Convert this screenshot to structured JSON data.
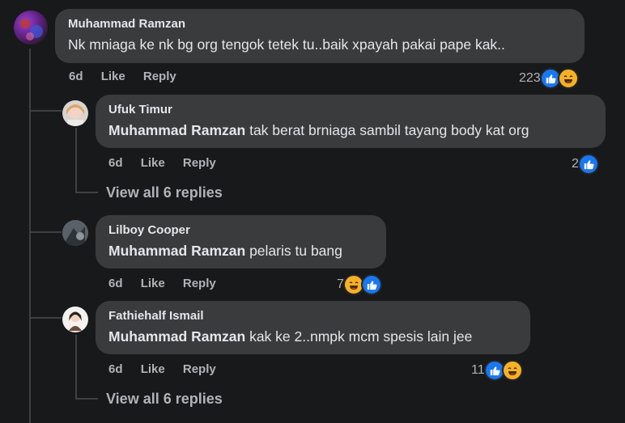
{
  "comments": [
    {
      "author": "Muhammad Ramzan",
      "mention": "",
      "text": "Nk mniaga ke nk bg org tengok tetek tu..baik xpayah pakai pape kak..",
      "time": "6d",
      "like": "Like",
      "reply": "Reply",
      "reaction_count": "223",
      "reactions": [
        "like-icon",
        "haha-icon"
      ]
    },
    {
      "author": "Ufuk Timur",
      "mention": "Muhammad Ramzan",
      "text": "tak berat brniaga sambil tayang body kat org",
      "time": "6d",
      "like": "Like",
      "reply": "Reply",
      "reaction_count": "2",
      "reactions": [
        "like-icon"
      ]
    },
    {
      "author": "Lilboy Cooper",
      "mention": "Muhammad Ramzan",
      "text": "pelaris tu bang",
      "time": "6d",
      "like": "Like",
      "reply": "Reply",
      "reaction_count": "7",
      "reactions": [
        "haha-icon",
        "like-icon"
      ]
    },
    {
      "author": "Fathiehalf Ismail",
      "mention": "Muhammad Ramzan",
      "text": "kak ke 2..nmpk mcm spesis lain jee",
      "time": "6d",
      "like": "Like",
      "reply": "Reply",
      "reaction_count": "11",
      "reactions": [
        "like-icon",
        "haha-icon"
      ]
    }
  ],
  "view_replies": [
    "View all 6 replies",
    "View all 6 replies"
  ],
  "colors": {
    "background": "#18191a",
    "bubble": "#3a3b3c",
    "like": "#1877f2",
    "haha": "#f7b125"
  }
}
